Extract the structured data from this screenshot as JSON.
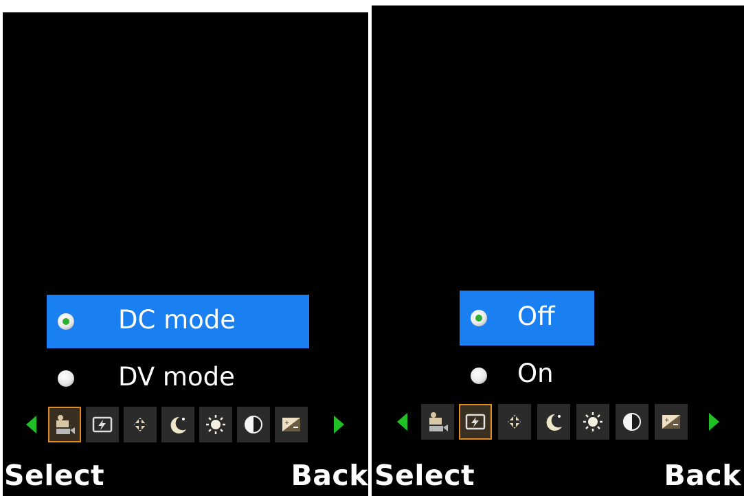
{
  "screens": [
    {
      "menu": [
        {
          "label": "DC mode",
          "selected": true
        },
        {
          "label": "DV mode",
          "selected": false
        }
      ],
      "active_tool": "capture-mode-icon",
      "softkeys": {
        "left": "Select",
        "right": "Back"
      }
    },
    {
      "menu": [
        {
          "label": "Off",
          "selected": true
        },
        {
          "label": "On",
          "selected": false
        }
      ],
      "active_tool": "flash-icon",
      "softkeys": {
        "left": "Select",
        "right": "Back"
      }
    }
  ],
  "toolbar_icons": [
    "capture-mode-icon",
    "flash-icon",
    "focus-icon",
    "night-mode-icon",
    "brightness-icon",
    "contrast-icon",
    "exposure-icon"
  ],
  "colors": {
    "selection": "#1a7ff0",
    "arrow": "#1fbf25",
    "active_border": "#e08a1e",
    "radio_dot": "#2fae2f"
  }
}
